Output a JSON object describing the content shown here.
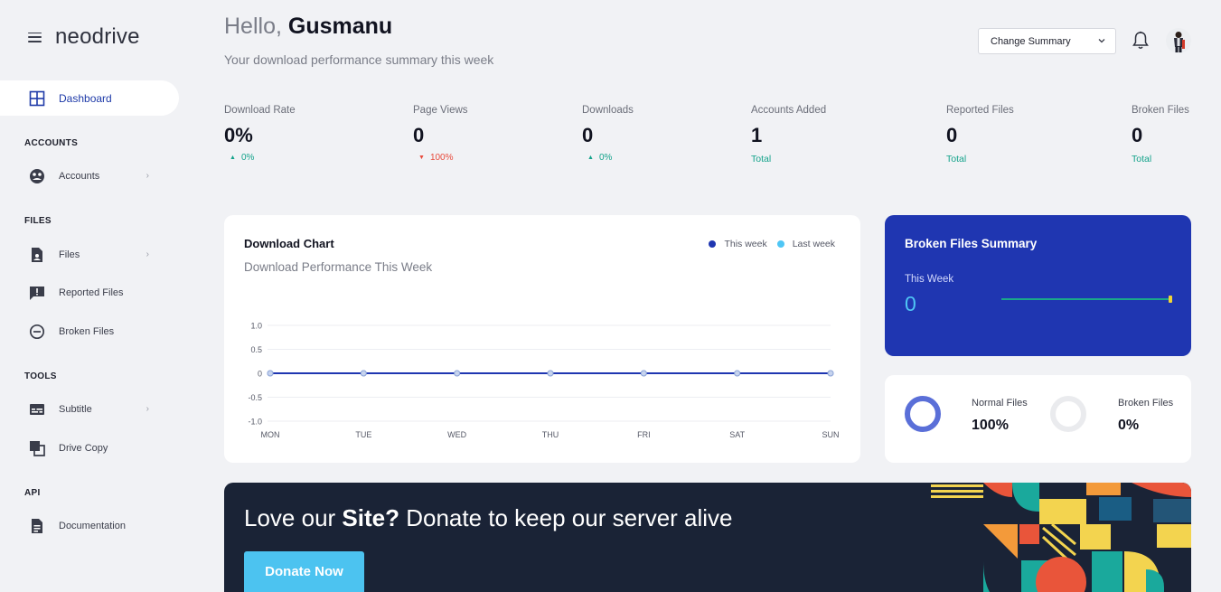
{
  "app": {
    "brand": "neodrive"
  },
  "sidebar": {
    "dashboard_label": "Dashboard",
    "sections": {
      "accounts": "ACCOUNTS",
      "files": "FILES",
      "tools": "TOOLS",
      "api": "API"
    },
    "items": {
      "accounts": "Accounts",
      "files": "Files",
      "reported_files": "Reported Files",
      "broken_files": "Broken Files",
      "subtitle": "Subtitle",
      "drive_copy": "Drive Copy",
      "documentation": "Documentation"
    }
  },
  "header": {
    "greeting_prefix": "Hello, ",
    "user_name": "Gusmanu",
    "subtitle": "Your download performance summary this week",
    "summary_select": "Change Summary"
  },
  "stats": [
    {
      "label": "Download Rate",
      "value": "0%",
      "delta": "0%",
      "trend": "up"
    },
    {
      "label": "Page Views",
      "value": "0",
      "delta": "100%",
      "trend": "down"
    },
    {
      "label": "Downloads",
      "value": "0",
      "delta": "0%",
      "trend": "up"
    },
    {
      "label": "Accounts Added",
      "value": "1",
      "note": "Total"
    },
    {
      "label": "Reported Files",
      "value": "0",
      "note": "Total"
    },
    {
      "label": "Broken Files",
      "value": "0",
      "note": "Total"
    }
  ],
  "download_chart": {
    "title": "Download Chart",
    "subtitle": "Download Performance This Week",
    "legend": [
      "This week",
      "Last week"
    ]
  },
  "chart_data": {
    "type": "line",
    "categories": [
      "MON",
      "TUE",
      "WED",
      "THU",
      "FRI",
      "SAT",
      "SUN"
    ],
    "series": [
      {
        "name": "This week",
        "values": [
          0,
          0,
          0,
          0,
          0,
          0,
          0
        ],
        "color": "#1f36b1"
      },
      {
        "name": "Last week",
        "values": [
          0,
          0,
          0,
          0,
          0,
          0,
          0
        ],
        "color": "#4fc6f5"
      }
    ],
    "yticks": [
      "1.0",
      "0.5",
      "0",
      "-0.5",
      "-1.0"
    ],
    "ylim": [
      -1,
      1
    ],
    "grid": true,
    "legend": "top-right"
  },
  "broken_summary": {
    "title": "Broken Files Summary",
    "period": "This Week",
    "value": "0"
  },
  "file_ratio": {
    "normal_label": "Normal Files",
    "normal_value": "100%",
    "broken_label": "Broken Files",
    "broken_value": "0%"
  },
  "banner": {
    "text_prefix": "Love our ",
    "text_bold": "Site?",
    "text_suffix": " Donate to keep our server alive",
    "button": "Donate Now"
  },
  "colors": {
    "primary": "#1f36b1",
    "accent": "#4fc6f5",
    "up": "#14a38b",
    "down": "#e84b3c",
    "banner_bg": "#1a2336"
  }
}
